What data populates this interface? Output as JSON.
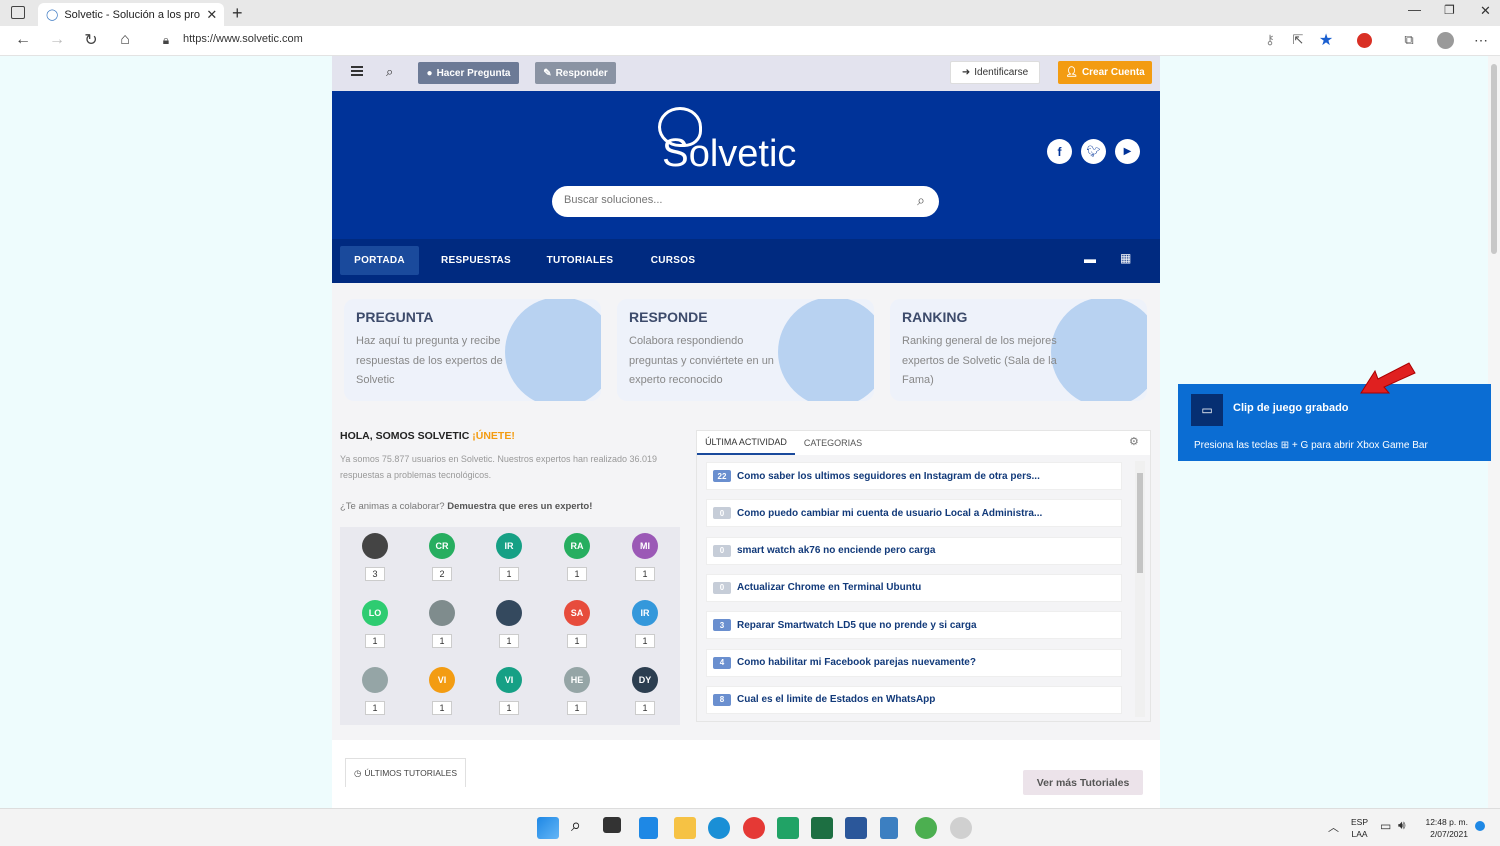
{
  "browser": {
    "tab_title": "Solvetic - Solución a los problem",
    "url": "https://www.solvetic.com"
  },
  "topnav": {
    "ask": "Hacer Pregunta",
    "answer": "Responder",
    "login": "Identificarse",
    "signup": "Crear Cuenta"
  },
  "hero": {
    "logo_text": "olvetic",
    "search_placeholder": "Buscar soluciones..."
  },
  "mainnav": [
    "PORTADA",
    "RESPUESTAS",
    "TUTORIALES",
    "CURSOS"
  ],
  "cards": [
    {
      "title": "PREGUNTA",
      "text": "Haz aquí tu pregunta y recibe respuestas de los expertos de Solvetic"
    },
    {
      "title": "RESPONDE",
      "text": "Colabora respondiendo preguntas y conviértete en un experto reconocido"
    },
    {
      "title": "RANKING",
      "text": "Ranking general de los mejores expertos de Solvetic (Sala de la Fama)"
    }
  ],
  "intro": {
    "heading": "HOLA, SOMOS SOLVETIC",
    "join": "¡ÚNETE!",
    "text": "Ya somos 75.877 usuarios en Solvetic. Nuestros expertos han realizado 36.019 respuestas a problemas tecnológicos.",
    "cta_prefix": "¿Te animas a colaborar?",
    "cta_bold": "Demuestra que eres un experto!"
  },
  "experts": [
    {
      "initials": "",
      "count": "3",
      "color": "#444444",
      "photo": true
    },
    {
      "initials": "CR",
      "count": "2",
      "color": "#27ae60"
    },
    {
      "initials": "IR",
      "count": "1",
      "color": "#16a085"
    },
    {
      "initials": "RA",
      "count": "1",
      "color": "#27ae60"
    },
    {
      "initials": "MI",
      "count": "1",
      "color": "#9b59b6"
    },
    {
      "initials": "LO",
      "count": "1",
      "color": "#2ecc71"
    },
    {
      "initials": "",
      "count": "1",
      "color": "#7f8c8d",
      "photo": true
    },
    {
      "initials": "",
      "count": "1",
      "color": "#34495e",
      "photo": true
    },
    {
      "initials": "SA",
      "count": "1",
      "color": "#e74c3c"
    },
    {
      "initials": "IR",
      "count": "1",
      "color": "#3498db"
    },
    {
      "initials": "",
      "count": "1",
      "color": "#95a5a6",
      "photo": true
    },
    {
      "initials": "VI",
      "count": "1",
      "color": "#f39c12"
    },
    {
      "initials": "VI",
      "count": "1",
      "color": "#16a085"
    },
    {
      "initials": "HE",
      "count": "1",
      "color": "#95a5a6"
    },
    {
      "initials": "DY",
      "count": "1",
      "color": "#2c3e50"
    }
  ],
  "activity": {
    "tab_active": "ÚLTIMA ACTIVIDAD",
    "tab_other": "CATEGORIAS",
    "items": [
      {
        "n": "22",
        "text": "Como saber los ultimos seguidores en Instagram de otra pers..."
      },
      {
        "n": "0",
        "text": "Como puedo cambiar mi cuenta de usuario Local a Administra..."
      },
      {
        "n": "0",
        "text": "smart watch ak76 no enciende pero carga"
      },
      {
        "n": "0",
        "text": "Actualizar Chrome en Terminal Ubuntu"
      },
      {
        "n": "3",
        "text": "Reparar Smartwatch LD5 que no prende y si carga"
      },
      {
        "n": "4",
        "text": "Como habilitar mi Facebook parejas nuevamente?"
      },
      {
        "n": "8",
        "text": "Cual es el limite de Estados en WhatsApp"
      }
    ]
  },
  "tutorials": {
    "tab": "ÚLTIMOS TUTORIALES",
    "more": "Ver más Tutoriales"
  },
  "toast": {
    "title": "Clip de juego grabado",
    "text_prefix": "Presiona las teclas",
    "text_suffix": "+ G para abrir Xbox Game Bar"
  },
  "taskbar": {
    "lang1": "ESP",
    "lang2": "LAA",
    "time": "12:48 p. m.",
    "date": "2/07/2021"
  },
  "colors": {
    "brand_blue": "#003399",
    "orange": "#f39c12",
    "toast": "#0b6dd3"
  }
}
